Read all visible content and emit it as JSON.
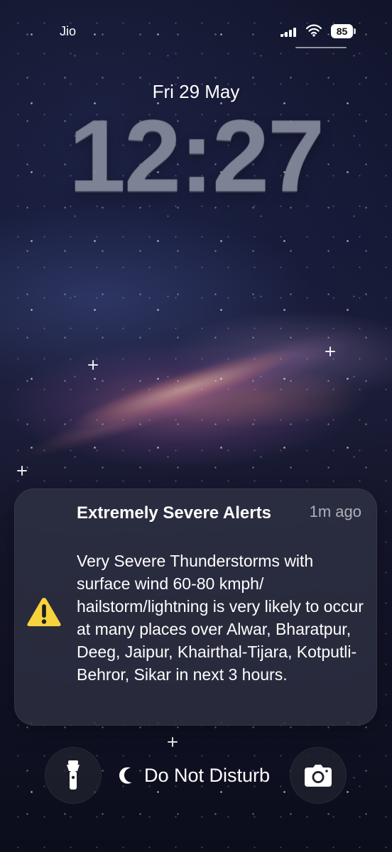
{
  "status_bar": {
    "carrier": "Jio",
    "battery": "85"
  },
  "lock_screen": {
    "date": "Fri 29 May",
    "time": "12:27"
  },
  "notification": {
    "title": "Extremely Severe Alerts",
    "time": "1m ago",
    "body": "Very Severe Thunderstorms with surface wind 60-80 kmph/ hailstorm/lightning is very likely to occur at many places over Alwar, Bharatpur, Deeg, Jaipur, Khairthal-Tijara, Kotputli-Behror, Sikar in next 3 hours.",
    "icon": "warning-icon"
  },
  "bottom_controls": {
    "dnd_label": "Do Not Disturb",
    "left_icon": "flashlight-icon",
    "right_icon": "camera-icon"
  }
}
